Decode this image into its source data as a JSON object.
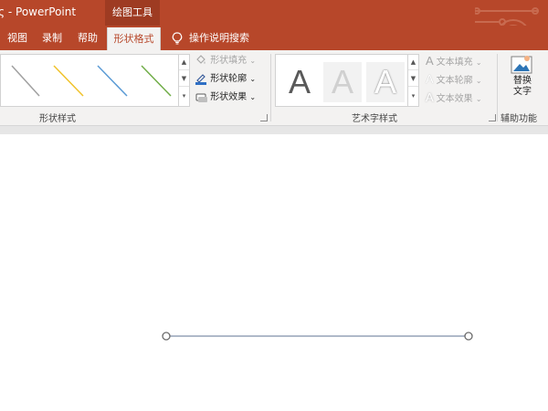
{
  "title": {
    "app": "- PowerPoint",
    "context_tool": "绘图工具"
  },
  "tabs": [
    {
      "label": "视图"
    },
    {
      "label": "录制"
    },
    {
      "label": "帮助"
    },
    {
      "label": "形状格式",
      "active": true
    }
  ],
  "tell_me": {
    "label": "操作说明搜索",
    "icon": "lightbulb-icon"
  },
  "shape_styles": {
    "group_label": "形状样式",
    "thumbnails": [
      {
        "name": "gray-line",
        "color": "#a0a0a0"
      },
      {
        "name": "gold-line",
        "color": "#f0c22a"
      },
      {
        "name": "blue-line",
        "color": "#5b9bd5"
      },
      {
        "name": "green-line",
        "color": "#70ad47"
      }
    ],
    "commands": {
      "fill": "形状填充",
      "outline": "形状轮廓",
      "effects": "形状效果"
    }
  },
  "wordart_styles": {
    "group_label": "艺术字样式",
    "letter": "A",
    "commands": {
      "fill": "文本填充",
      "outline": "文本轮廓",
      "effects": "文本效果"
    }
  },
  "accessibility": {
    "group_label": "辅助功能",
    "alt_text_line1": "替换",
    "alt_text_line2": "文字"
  },
  "colors": {
    "accent": "#b7472a",
    "ribbon_bg": "#f3f2f1",
    "line_shape": "#7f8fa9"
  }
}
